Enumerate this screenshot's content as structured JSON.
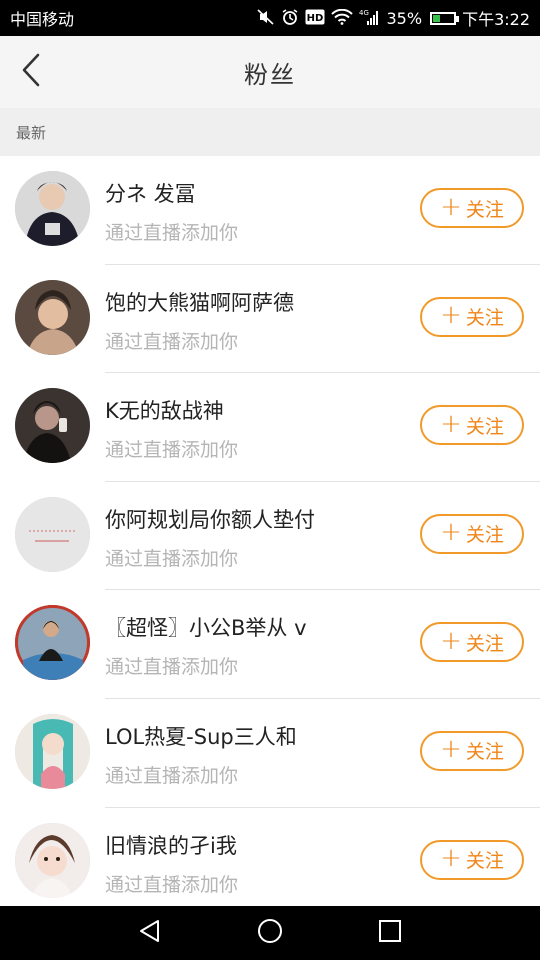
{
  "status_bar": {
    "carrier": "中国移动",
    "network": "4G",
    "battery_percent": "35%",
    "battery_level": 0.35,
    "time": "下午3:22",
    "hd_label": "HD",
    "icons": [
      "mute-icon",
      "alarm-icon",
      "hd-icon",
      "wifi-icon",
      "signal-icon",
      "battery-icon"
    ]
  },
  "nav": {
    "title": "粉丝",
    "back_icon": "chevron-left-icon"
  },
  "section": {
    "label": "最新"
  },
  "follow_label": "关注",
  "colors": {
    "accent": "#f08519",
    "button_border": "#f19a2a",
    "subtext": "#b5b5b5",
    "section_bg": "#efefef",
    "nav_bg": "#f5f5f5"
  },
  "fans": [
    {
      "name": "分ネ 发冨",
      "source": "通过直播添加你"
    },
    {
      "name": "饱的大熊猫啊阿萨德",
      "source": "通过直播添加你"
    },
    {
      "name": "K无的敌战神",
      "source": "通过直播添加你"
    },
    {
      "name": "你阿规划局你额人垫付",
      "source": "通过直播添加你"
    },
    {
      "name": "〖超怪〗小公B举从 v",
      "source": "通过直播添加你"
    },
    {
      "name": "LOL热夏-Sup三人和",
      "source": "通过直播添加你"
    },
    {
      "name": "旧情浪的孑i我",
      "source": "通过直播添加你"
    }
  ],
  "system_nav": [
    "back-triangle-icon",
    "home-circle-icon",
    "recents-square-icon"
  ]
}
